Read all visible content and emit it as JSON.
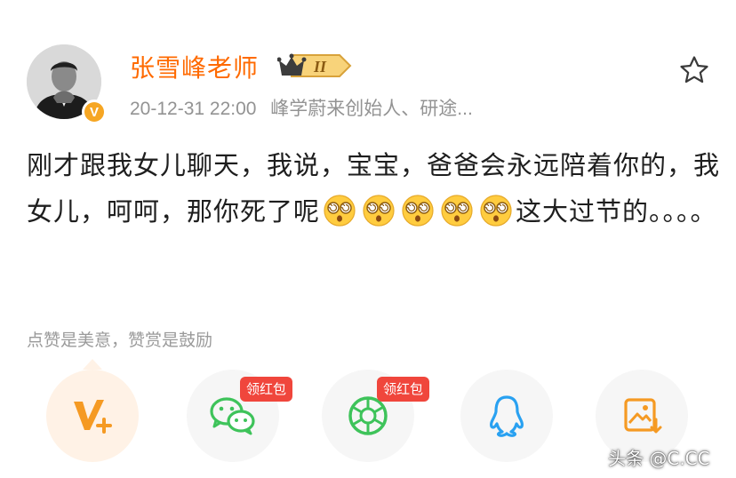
{
  "author": {
    "name": "张雪峰老师",
    "level_badge": "II",
    "verified_mark": "V",
    "post_time": "20-12-31 22:00",
    "description": "峰学蔚来创始人、研途..."
  },
  "post": {
    "text_before_emoji": "刚才跟我女儿聊天，我说，宝宝，爸爸会永远陪着你的，我女儿，呵呵，那你死了呢",
    "emoji_icon": "dizzy-face-emoji",
    "emoji_count": 5,
    "text_after_emoji": "这大过节的。。。。"
  },
  "tip": {
    "text": "点赞是美意，赞赏是鼓励"
  },
  "share": {
    "items": [
      {
        "icon": "v-plus-icon",
        "badge": ""
      },
      {
        "icon": "wechat-icon",
        "badge": "领红包"
      },
      {
        "icon": "moments-icon",
        "badge": "领红包"
      },
      {
        "icon": "qq-icon",
        "badge": ""
      },
      {
        "icon": "save-image-icon",
        "badge": ""
      }
    ]
  },
  "watermark": {
    "text": "头条 @C.CC"
  },
  "colors": {
    "username": "#ff6a00",
    "accent_orange": "#f6a623",
    "share_badge_red": "#f0463c",
    "wechat_green": "#3ec35a",
    "qq_blue": "#29a1f1"
  }
}
